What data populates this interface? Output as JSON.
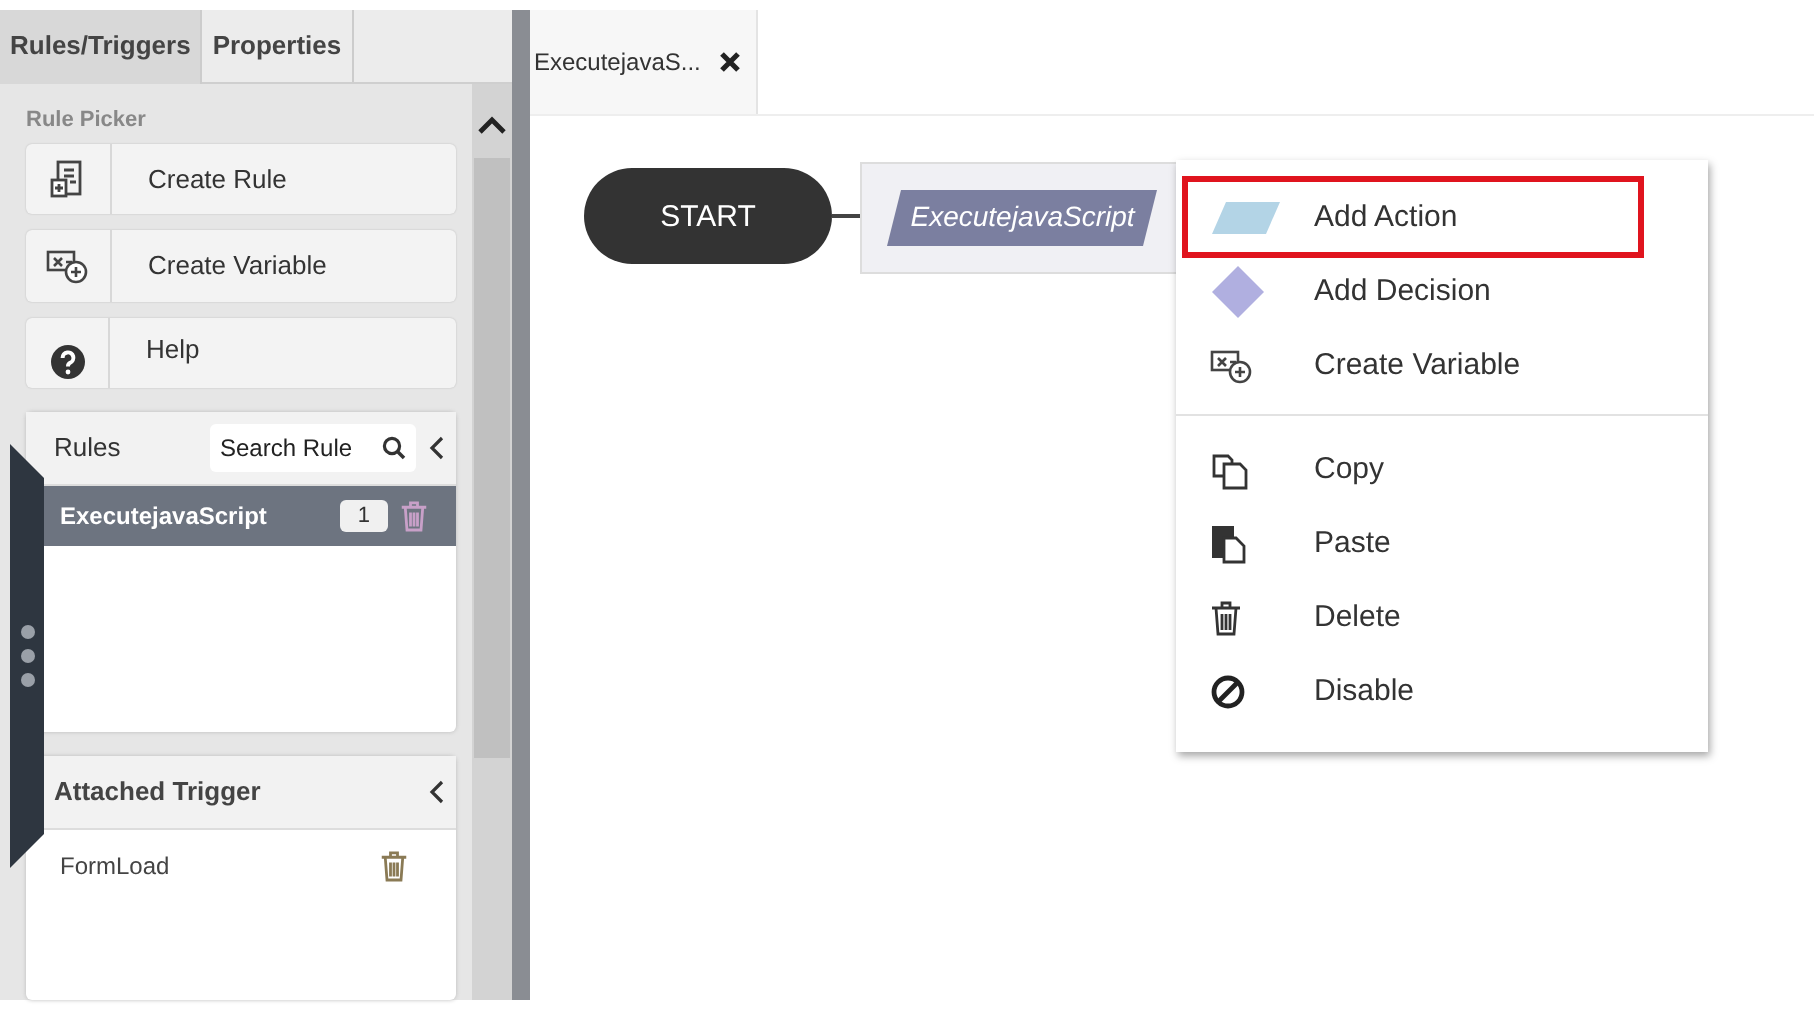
{
  "sidebar_tabs": [
    {
      "label": "Rules/Triggers",
      "selected": true
    },
    {
      "label": "Properties",
      "selected": false
    }
  ],
  "rule_picker": {
    "title": "Rule Picker",
    "buttons": [
      {
        "label": "Create Rule",
        "kind": "rule"
      },
      {
        "label": "Create Variable",
        "kind": "variable"
      },
      {
        "label": "Help",
        "kind": "help"
      }
    ]
  },
  "rules": {
    "title": "Rules",
    "search": {
      "placeholder": "Search Rule"
    },
    "items": [
      {
        "name": "ExecutejavaScript",
        "count": "1",
        "selected": true
      }
    ]
  },
  "attached_trigger": {
    "title": "Attached Trigger",
    "items": [
      {
        "name": "FormLoad"
      }
    ]
  },
  "editor_tabs": [
    {
      "label": "ExecutejavaS..."
    }
  ],
  "canvas": {
    "start": "START",
    "action": "ExecutejavaScript"
  },
  "context_menu": {
    "groups": [
      [
        {
          "label": "Add Action",
          "kind": "action",
          "highlighted": true
        },
        {
          "label": "Add Decision",
          "kind": "decision",
          "highlighted": false
        },
        {
          "label": "Create Variable",
          "kind": "variable",
          "highlighted": false
        }
      ],
      [
        {
          "label": "Copy",
          "kind": "copy",
          "highlighted": false
        },
        {
          "label": "Paste",
          "kind": "paste",
          "highlighted": false
        },
        {
          "label": "Delete",
          "kind": "delete",
          "highlighted": false
        },
        {
          "label": "Disable",
          "kind": "disable",
          "highlighted": false
        }
      ]
    ]
  }
}
